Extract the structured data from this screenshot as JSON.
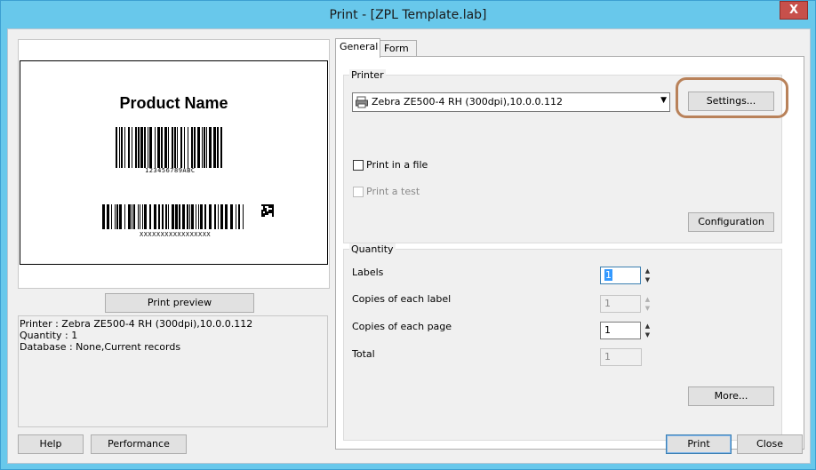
{
  "window": {
    "title": "Print - [ZPL Template.lab]",
    "close_glyph": "X"
  },
  "preview": {
    "product_name": "Product Name",
    "barcode1_text": "123456789ABC",
    "barcode2_text": "XXXXXXXXXXXXXXXXX",
    "print_preview_label": "Print preview"
  },
  "info": {
    "printer": "Printer : Zebra ZE500-4 RH (300dpi),10.0.0.112",
    "quantity": "Quantity : 1",
    "database": "Database : None,Current records"
  },
  "tabs": [
    {
      "label": "General",
      "active": true
    },
    {
      "label": "Form",
      "active": false
    }
  ],
  "printer_group": {
    "title": "Printer",
    "selected_printer": "Zebra ZE500-4 RH (300dpi),10.0.0.112",
    "printer_icon": "printer-icon",
    "settings_label": "Settings...",
    "print_in_file_label": "Print in a file",
    "print_test_label": "Print a test",
    "configuration_label": "Configuration"
  },
  "quantity_group": {
    "title": "Quantity",
    "labels_label": "Labels",
    "labels_value": "1",
    "copies_label_label": "Copies of each label",
    "copies_label_value": "1",
    "copies_page_label": "Copies of each page",
    "copies_page_value": "1",
    "total_label": "Total",
    "total_value": "1",
    "more_label": "More..."
  },
  "footer": {
    "help_label": "Help",
    "performance_label": "Performance",
    "print_label": "Print",
    "close_label": "Close"
  },
  "colors": {
    "titlebar": "#68c8eb",
    "close_button": "#c7504b",
    "highlight_ring": "#b9825a"
  }
}
